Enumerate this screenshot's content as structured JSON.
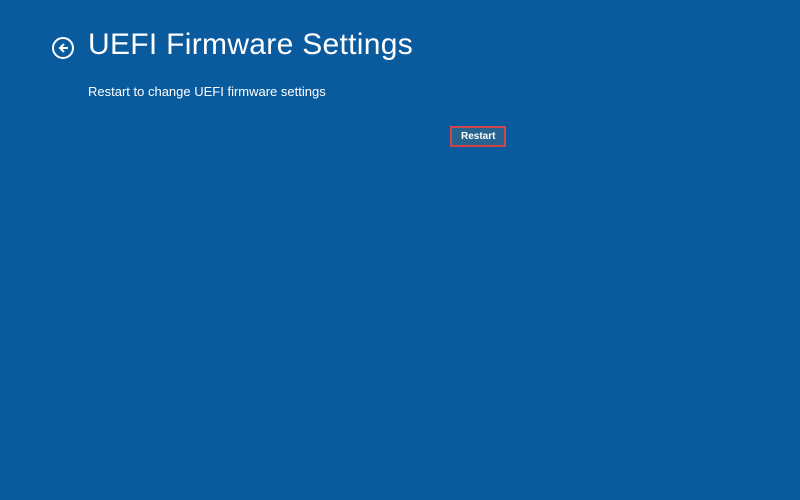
{
  "header": {
    "title": "UEFI Firmware Settings",
    "subtitle": "Restart to change UEFI firmware settings"
  },
  "actions": {
    "restart_label": "Restart"
  }
}
